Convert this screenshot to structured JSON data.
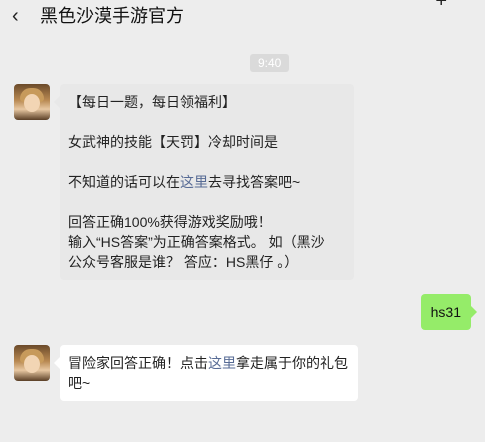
{
  "header": {
    "title": "黑色沙漠手游官方",
    "back_icon": "chevron-left-icon",
    "more_icon": "plus-icon"
  },
  "timestamp": "9:40",
  "messages": {
    "first": {
      "line1": "【每日一题，每日领福利】",
      "line2": "女武神的技能【天罚】冷却时间是",
      "line3_prefix": "不知道的话可以在",
      "line3_link": "这里",
      "line3_suffix": "去寻找答案吧~",
      "line4": "回答正确100%获得游戏奖励哦！",
      "line5": "输入“HS答案”为正确答案格式。 如（黑沙",
      "line6": "公众号客服是谁？ 答应：HS黑仔 。）"
    },
    "reply": "hs31",
    "second": {
      "prefix": "冒险家回答正确！点击",
      "link": "这里",
      "suffix": "拿走属于你的礼包",
      "line2": "吧~"
    }
  },
  "colors": {
    "background": "#ededed",
    "outgoing_bubble": "#95ec69",
    "link": "#576b95"
  }
}
